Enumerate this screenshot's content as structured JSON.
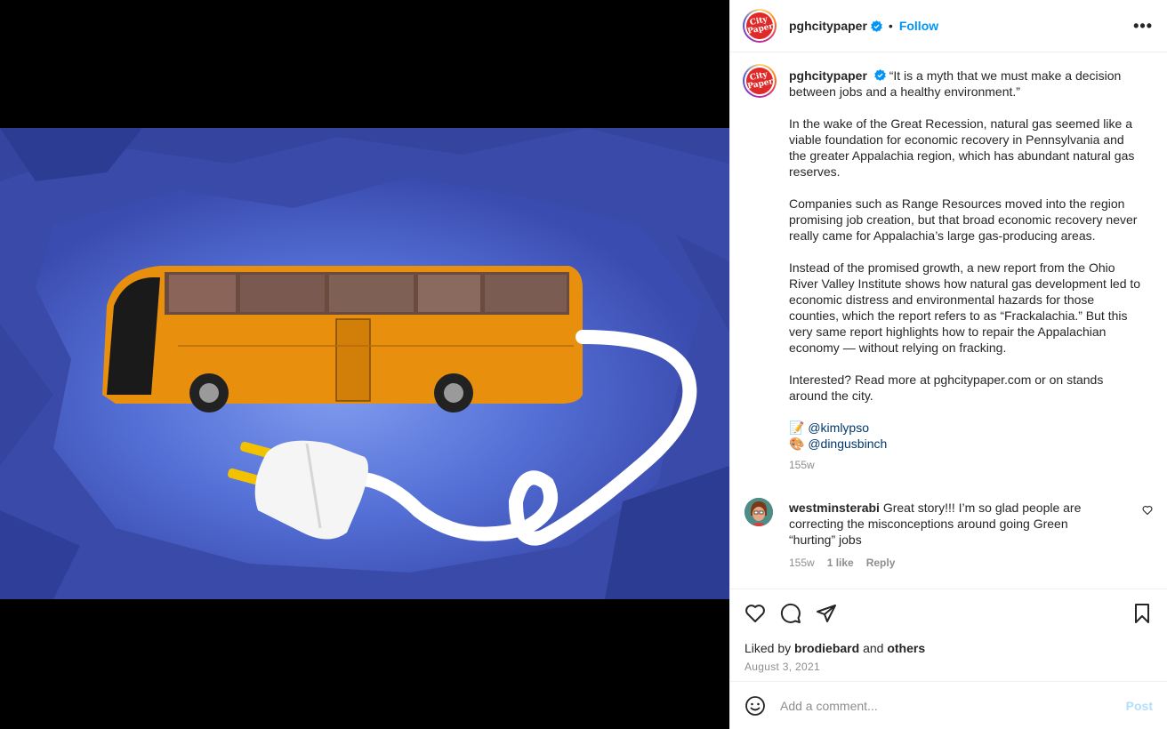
{
  "header": {
    "username": "pghcitypaper",
    "follow_label": "Follow",
    "separator": "•",
    "more_label": "•••",
    "logo_line1": "City",
    "logo_line2": "Paper"
  },
  "caption": {
    "username": "pghcitypaper",
    "paragraphs": [
      "“It is a myth that we must make a decision between jobs and a healthy environment.”",
      "In the wake of the Great Recession, natural gas seemed like a viable foundation for economic recovery in Pennsylvania and the greater Appalachia region, which has abundant natural gas reserves.",
      "Companies such as Range Resources moved into the region promising job creation, but that broad economic recovery never really came for Appalachia’s large gas-producing areas.",
      "Instead of the promised growth, a new report from the Ohio River Valley Institute shows how natural gas development led to economic distress and environmental hazards for those counties, which the report refers to as “Frackalachia.” But this very same report highlights how to repair the Appalachian economy — without relying on fracking.",
      "Interested? Read more at pghcitypaper.com or on stands around the city."
    ],
    "credits": [
      {
        "emoji": "📝",
        "handle": "@kimlypso"
      },
      {
        "emoji": "🎨",
        "handle": "@dingusbinch"
      }
    ],
    "age": "155w"
  },
  "comment": {
    "username": "westminsterabi",
    "text": "Great story!!! I’m so glad people are correcting the misconceptions around going Green “hurting” jobs",
    "age": "155w",
    "likes": "1 like",
    "reply_label": "Reply"
  },
  "footer": {
    "liked_by_prefix": "Liked by",
    "liked_by_user": "brodiebard",
    "liked_by_and": "and",
    "liked_by_others": "others",
    "date": "August 3, 2021"
  },
  "add_comment": {
    "placeholder": "Add a comment...",
    "post_label": "Post"
  },
  "colors": {
    "accent": "#0095f6",
    "bus": "#e8900e",
    "background_art": "#3e4fae"
  }
}
